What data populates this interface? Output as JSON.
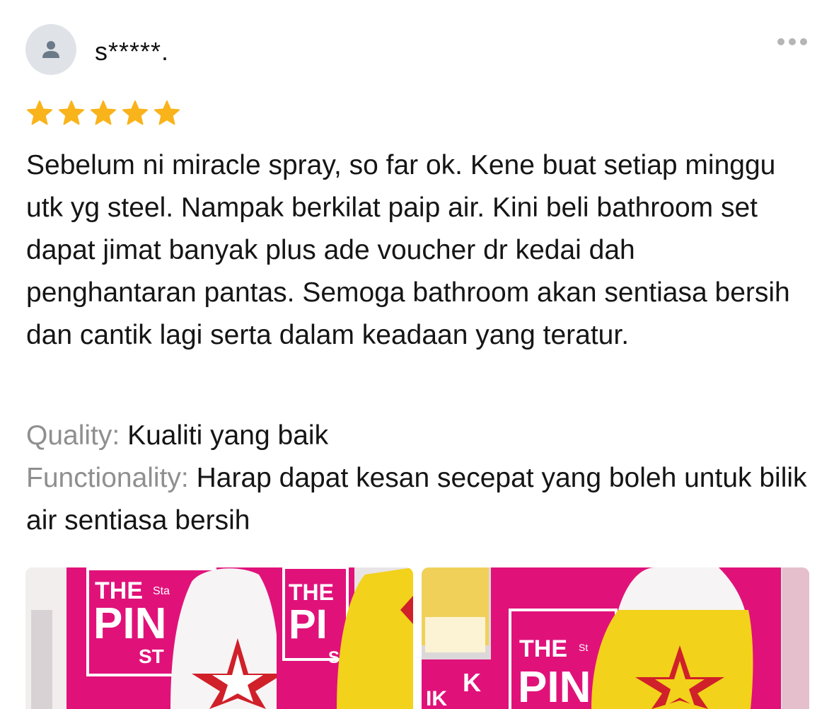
{
  "reviewer": {
    "avatar_icon": "person-icon",
    "name": "s*****."
  },
  "menu": {
    "icon": "more-options-icon"
  },
  "rating": {
    "stars": 5,
    "max": 5,
    "star_color": "#F9B31B"
  },
  "review_text": "Sebelum ni miracle spray, so far ok. Kene buat setiap minggu utk yg steel. Nampak berkilat paip air. Kini beli bathroom set dapat jimat banyak plus ade voucher dr kedai dah penghantaran pantas. Semoga bathroom akan sentiasa bersih dan cantik lagi serta dalam keadaan yang teratur.",
  "attributes": [
    {
      "label": "Quality:",
      "value": "Kualiti yang baik"
    },
    {
      "label": "Functionality:",
      "value": "Harap dapat kesan secepat yang boleh untuk bilik air sentiasa bersih"
    }
  ],
  "photos": [
    {
      "name": "review-photo-1",
      "product_text": [
        "THE",
        "PIN",
        "ST",
        "Sta",
        "THE",
        "PI",
        "S"
      ]
    },
    {
      "name": "review-photo-2",
      "product_text": [
        "THE",
        "PIN",
        "St",
        "K",
        "IK"
      ]
    }
  ],
  "colors": {
    "brand_pink": "#E0127A",
    "yellow": "#F2D21B",
    "red_star": "#D0202A"
  }
}
